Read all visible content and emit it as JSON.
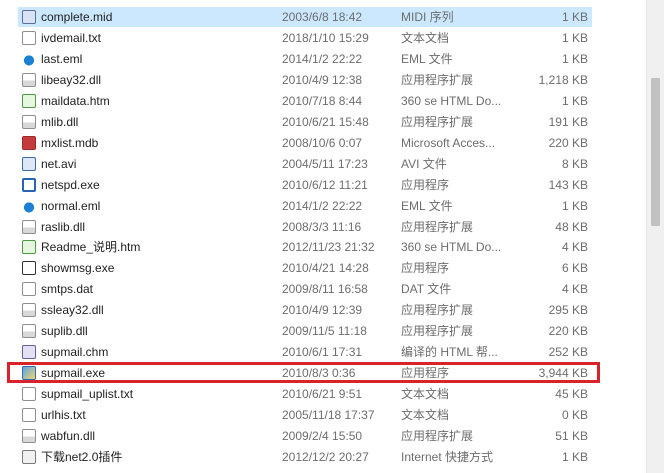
{
  "files": [
    {
      "name": "complete.mid",
      "date": "2003/6/8 18:42",
      "type": "MIDI 序列",
      "size": "1 KB",
      "icon": "midi-icon",
      "selected": true
    },
    {
      "name": "ivdemail.txt",
      "date": "2018/1/10 15:29",
      "type": "文本文档",
      "size": "1 KB",
      "icon": "text-file-icon"
    },
    {
      "name": "last.eml",
      "date": "2014/1/2 22:22",
      "type": "EML 文件",
      "size": "1 KB",
      "icon": "eml-icon"
    },
    {
      "name": "libeay32.dll",
      "date": "2010/4/9 12:38",
      "type": "应用程序扩展",
      "size": "1,218 KB",
      "icon": "dll-icon"
    },
    {
      "name": "maildata.htm",
      "date": "2010/7/18 8:44",
      "type": "360 se HTML Do...",
      "size": "1 KB",
      "icon": "html-icon"
    },
    {
      "name": "mlib.dll",
      "date": "2010/6/21 15:48",
      "type": "应用程序扩展",
      "size": "191 KB",
      "icon": "dll-icon"
    },
    {
      "name": "mxlist.mdb",
      "date": "2008/10/6 0:07",
      "type": "Microsoft Acces...",
      "size": "220 KB",
      "icon": "access-db-icon"
    },
    {
      "name": "net.avi",
      "date": "2004/5/11 17:23",
      "type": "AVI 文件",
      "size": "8 KB",
      "icon": "video-icon"
    },
    {
      "name": "netspd.exe",
      "date": "2010/6/12 11:21",
      "type": "应用程序",
      "size": "143 KB",
      "icon": "network-exe-icon"
    },
    {
      "name": "normal.eml",
      "date": "2014/1/2 22:22",
      "type": "EML 文件",
      "size": "1 KB",
      "icon": "eml-icon"
    },
    {
      "name": "raslib.dll",
      "date": "2008/3/3 11:16",
      "type": "应用程序扩展",
      "size": "48 KB",
      "icon": "dll-icon"
    },
    {
      "name": "Readme_说明.htm",
      "date": "2012/11/23 21:32",
      "type": "360 se HTML Do...",
      "size": "4 KB",
      "icon": "html-icon"
    },
    {
      "name": "showmsg.exe",
      "date": "2010/4/21 14:28",
      "type": "应用程序",
      "size": "6 KB",
      "icon": "showmsg-exe-icon"
    },
    {
      "name": "smtps.dat",
      "date": "2009/8/11 16:58",
      "type": "DAT 文件",
      "size": "4 KB",
      "icon": "dat-file-icon"
    },
    {
      "name": "ssleay32.dll",
      "date": "2010/4/9 12:39",
      "type": "应用程序扩展",
      "size": "295 KB",
      "icon": "dll-icon"
    },
    {
      "name": "suplib.dll",
      "date": "2009/11/5 11:18",
      "type": "应用程序扩展",
      "size": "220 KB",
      "icon": "dll-icon"
    },
    {
      "name": "supmail.chm",
      "date": "2010/6/1 17:31",
      "type": "编译的 HTML 帮...",
      "size": "252 KB",
      "icon": "help-file-icon"
    },
    {
      "name": "supmail.exe",
      "date": "2010/8/3 0:36",
      "type": "应用程序",
      "size": "3,944 KB",
      "icon": "supmail-exe-icon",
      "highlighted": true
    },
    {
      "name": "supmail_uplist.txt",
      "date": "2010/6/21 9:51",
      "type": "文本文档",
      "size": "45 KB",
      "icon": "text-file-icon"
    },
    {
      "name": "urlhis.txt",
      "date": "2005/11/18 17:37",
      "type": "文本文档",
      "size": "0 KB",
      "icon": "text-file-icon"
    },
    {
      "name": "wabfun.dll",
      "date": "2009/2/4 15:50",
      "type": "应用程序扩展",
      "size": "51 KB",
      "icon": "dll-icon"
    },
    {
      "name": "下载net2.0插件",
      "date": "2012/12/2 20:27",
      "type": "Internet 快捷方式",
      "size": "1 KB",
      "icon": "shortcut-icon"
    }
  ],
  "colors": {
    "selection": "#cce8ff",
    "highlight_border": "#d9232a",
    "secondary_text": "#6d6d6d"
  }
}
